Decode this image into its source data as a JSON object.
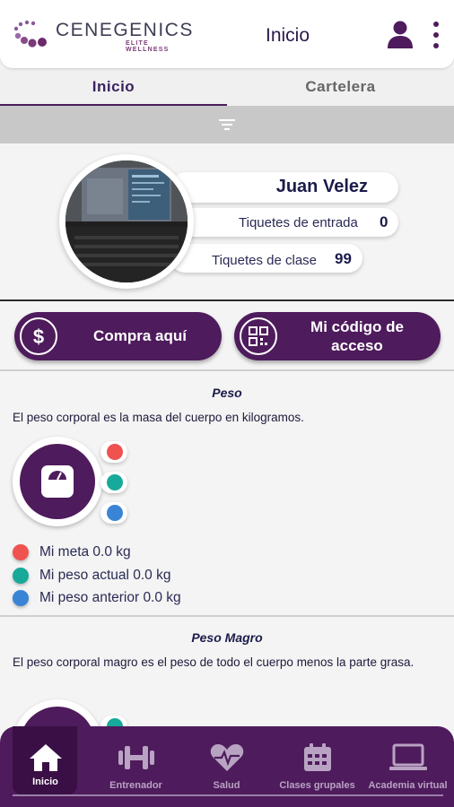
{
  "header": {
    "logo_text": "CENEGENICS",
    "logo_subtext": "ELITE WELLNESS",
    "title": "Inicio",
    "user_icon": "user-icon",
    "menu_icon": "more-vert-icon"
  },
  "tabs": [
    {
      "label": "Inicio",
      "active": true
    },
    {
      "label": "Cartelera",
      "active": false
    }
  ],
  "filter_icon": "filter-icon",
  "profile": {
    "name": "Juan Velez",
    "entry_tickets_label": "Tiquetes de entrada",
    "entry_tickets_value": "0",
    "class_tickets_label": "Tiquetes de clase",
    "class_tickets_value": "99"
  },
  "actions": {
    "buy_label": "Compra aquí",
    "buy_icon": "dollar-icon",
    "access_label_line1": "Mi código de",
    "access_label_line2": "acceso",
    "access_icon": "qr-code-icon"
  },
  "peso": {
    "title": "Peso",
    "description": "El peso corporal es la masa del cuerpo en kilogramos.",
    "legend": [
      {
        "label": "Mi meta 0.0 kg",
        "color": "#f0524f"
      },
      {
        "label": "Mi peso actual 0.0 kg",
        "color": "#17a99a"
      },
      {
        "label": "Mi peso anterior 0.0 kg",
        "color": "#3a84d6"
      }
    ]
  },
  "peso_magro": {
    "title": "Peso Magro",
    "description": "El peso corporal magro es el peso de todo el cuerpo menos la parte grasa."
  },
  "bottom_nav": [
    {
      "label": "Inicio",
      "icon": "home-icon",
      "active": true
    },
    {
      "label": "Entrenador",
      "icon": "dumbbell-icon",
      "active": false
    },
    {
      "label": "Salud",
      "icon": "heart-pulse-icon",
      "active": false
    },
    {
      "label": "Clases grupales",
      "icon": "calendar-icon",
      "active": false
    },
    {
      "label": "Academia virtual",
      "icon": "laptop-icon",
      "active": false
    }
  ],
  "colors": {
    "brand_purple": "#4e1b5c",
    "meta_red": "#f0524f",
    "actual_teal": "#17a99a",
    "anterior_blue": "#3a84d6"
  }
}
